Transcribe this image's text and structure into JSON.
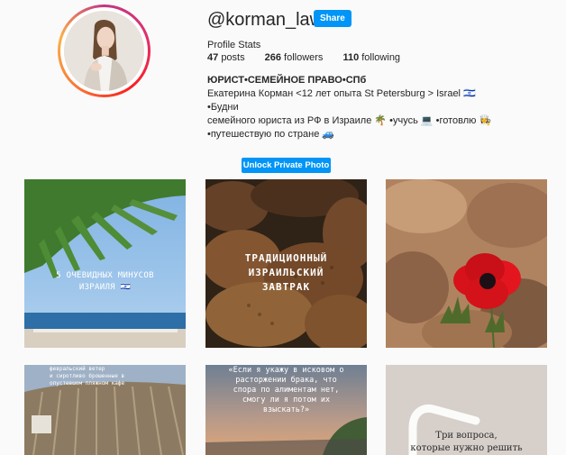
{
  "profile": {
    "username": "@korman_law",
    "share_label": "Share",
    "stats_title": "Profile Stats",
    "posts_count": "47",
    "posts_label": "posts",
    "followers_count": "266",
    "followers_label": "followers",
    "following_count": "110",
    "following_label": "following",
    "full_name": "ЮРИСТ•СЕМЕЙНОЕ ПРАВО•СПб",
    "bio_line1": "Екатерина Корман <12 лет опыта St Petersburg > Israel 🇮🇱 •Будни",
    "bio_line2": "семейного юриста из РФ в Израиле 🌴 •учусь 💻 •готовлю 👩‍🍳",
    "bio_line3": "•путешествую по стране 🚙"
  },
  "unlock_label": "Unlock Private Photo",
  "posts": [
    {
      "id": "post-1",
      "caption_line1": "5 ОЧЕВИДНЫХ МИНУСОВ",
      "caption_line2": "ИЗРАИЛЯ 🇮🇱"
    },
    {
      "id": "post-2",
      "caption_line1": "ТРАДИЦИОННЫЙ",
      "caption_line2": "ИЗРАИЛЬСКИЙ",
      "caption_line3": "ЗАВТРАК"
    },
    {
      "id": "post-3"
    },
    {
      "id": "post-4",
      "caption_line1": "февральский ветер",
      "caption_line2": "и сиротливо брошенные в",
      "caption_line3": "опустевшем пляжном кафе"
    },
    {
      "id": "post-5",
      "caption_line1": "«Если я укажу в исковом о",
      "caption_line2": "расторжении брака, что",
      "caption_line3": "спора по алиментам нет,",
      "caption_line4": "смогу ли я потом их",
      "caption_line5": "взыскать?»"
    },
    {
      "id": "post-6",
      "caption_line1": "Три вопроса,",
      "caption_line2": "которые нужно решить"
    }
  ],
  "colors": {
    "accent": "#0095f6",
    "background": "#fafafa",
    "text": "#262626"
  }
}
